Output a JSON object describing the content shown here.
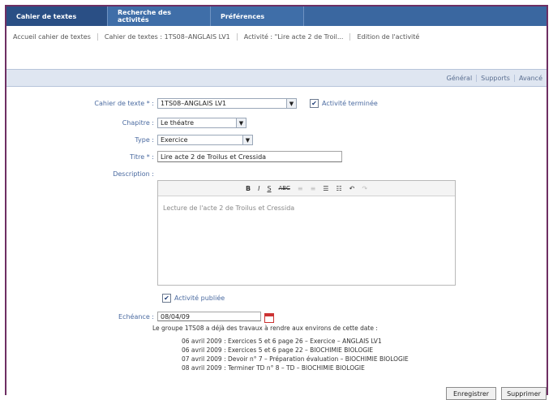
{
  "tabs": [
    "Cahier de textes",
    "Recherche des activités",
    "Préférences"
  ],
  "breadcrumb": [
    "Accueil cahier de textes",
    "Cahier de textes : 1TS08–ANGLAIS LV1",
    "Activité : \"Lire acte 2 de Troil...",
    "Edition de l'activité"
  ],
  "subnav": [
    "Général",
    "Supports",
    "Avancé"
  ],
  "form": {
    "cahier_label": "Cahier de texte * :",
    "cahier_value": "1TS08–ANGLAIS LV1",
    "terminee_label": "Activité terminée",
    "chapitre_label": "Chapitre :",
    "chapitre_value": "Le théatre",
    "type_label": "Type :",
    "type_value": "Exercice",
    "titre_label": "Titre * :",
    "titre_value": "Lire acte 2 de Troilus et Cressida",
    "description_label": "Description :",
    "description_value": "Lecture de l'acte 2 de Troilus et Cressida",
    "publiee_label": "Activité publiée",
    "echeance_label": "Echéance :",
    "echeance_value": "08/04/09"
  },
  "toolbar": {
    "bold": "B",
    "italic": "I",
    "underline": "S",
    "strike": "ABC",
    "undo": "↶",
    "redo": "↷"
  },
  "info": "Le groupe 1TS08 a déjà des travaux à rendre aux environs de cette date :",
  "dates": [
    "06 avril 2009 : Exercices 5 et 6 page 26 – Exercice – ANGLAIS LV1",
    "06 avril 2009 : Exercices 5 et 6 page 22 – BIOCHIMIE BIOLOGIE",
    "07 avril 2009 : Devoir n° 7 – Préparation évaluation – BIOCHIMIE BIOLOGIE",
    "08 avril 2009 : Terminer TD n° 8 – TD – BIOCHIMIE BIOLOGIE"
  ],
  "buttons": {
    "save": "Enregistrer",
    "delete": "Supprimer"
  },
  "colors": {
    "frame": "#6e2f63",
    "tabbar": "#2f5d96",
    "label": "#4a6aa0"
  }
}
